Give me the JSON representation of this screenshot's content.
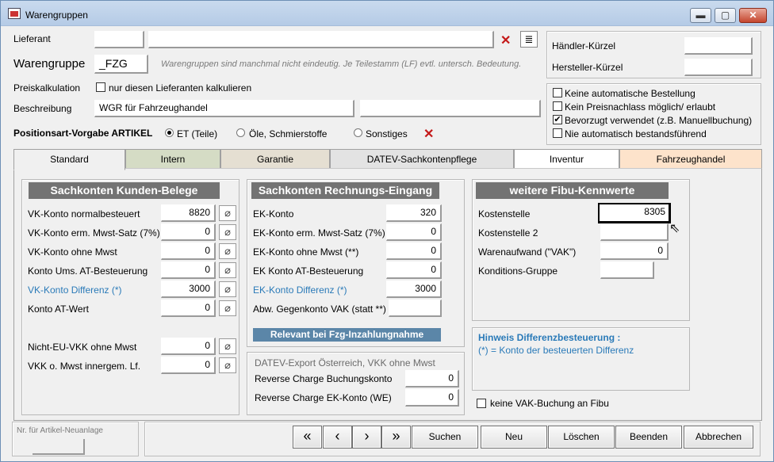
{
  "window": {
    "title": "Warengruppen",
    "minimize": "▬",
    "maximize": "▢",
    "close": "✕"
  },
  "header": {
    "lieferant_label": "Lieferant",
    "lieferant_code": "",
    "lieferant_name": "",
    "warengruppe_label": "Warengruppe",
    "warengruppe_value": "_FZG",
    "warengruppe_hint": "Warengruppen sind manchmal nicht eindeutig. Je Teilestamm (LF) evtl. untersch. Bedeutung.",
    "preiskalk_label": "Preiskalkulation",
    "preiskalk_checkbox": "nur diesen Lieferanten kalkulieren",
    "beschreibung_label": "Beschreibung",
    "beschreibung_value": "WGR für Fahrzeughandel",
    "beschreibung_value2": "",
    "positionsart_label": "Positionsart-Vorgabe ARTIKEL",
    "radio_et": "ET (Teile)",
    "radio_oele": "Öle, Schmierstoffe",
    "radio_sonstiges": "Sonstiges",
    "haendler_label": "Händler-Kürzel",
    "haendler_value": "",
    "hersteller_label": "Hersteller-Kürzel",
    "hersteller_value": ""
  },
  "options": [
    {
      "label": "Keine automatische Bestellung",
      "checked": false
    },
    {
      "label": "Kein Preisnachlass möglich/ erlaubt",
      "checked": false
    },
    {
      "label": "Bevorzugt verwendet (z.B. Manuellbuchung)",
      "checked": true
    },
    {
      "label": "Nie automatisch bestandsführend",
      "checked": false
    }
  ],
  "tabs": [
    {
      "label": "Standard",
      "color": "#f0f0f0"
    },
    {
      "label": "Intern",
      "color": "#d5dcc5"
    },
    {
      "label": "Garantie",
      "color": "#e5dfd2"
    },
    {
      "label": "DATEV-Sachkontenpflege",
      "color": "#e3e3e3"
    },
    {
      "label": "Inventur",
      "color": "#ffffff"
    },
    {
      "label": "Fahrzeughandel",
      "color": "#fde3cb"
    }
  ],
  "kunden": {
    "title": "Sachkonten Kunden-Belege",
    "rows": [
      {
        "label": "VK-Konto normalbesteuert",
        "value": "8820"
      },
      {
        "label": "VK-Konto erm. Mwst-Satz (7%)",
        "value": "0"
      },
      {
        "label": "VK-Konto ohne Mwst",
        "value": "0"
      },
      {
        "label": "Konto Ums. AT-Besteuerung",
        "value": "0"
      },
      {
        "label": "VK-Konto Differenz (*)",
        "value": "3000"
      },
      {
        "label": "Konto AT-Wert",
        "value": "0"
      },
      {
        "label": "Nicht-EU-VKK ohne Mwst",
        "value": "0"
      },
      {
        "label": "VKK o. Mwst innergem. Lf.",
        "value": "0"
      }
    ]
  },
  "rechnung": {
    "title": "Sachkonten Rechnungs-Eingang",
    "rows": [
      {
        "label": "EK-Konto",
        "value": "320"
      },
      {
        "label": "EK-Konto erm. Mwst-Satz (7%)",
        "value": "0"
      },
      {
        "label": "EK-Konto ohne Mwst (**)",
        "value": "0"
      },
      {
        "label": "EK Konto AT-Besteuerung",
        "value": "0"
      },
      {
        "label": "EK-Konto Differenz (*)",
        "value": "3000"
      },
      {
        "label": "Abw. Gegenkonto VAK (statt **)",
        "value": ""
      }
    ],
    "relevant": "Relevant bei Fzg-Inzahlungnahme"
  },
  "datev": {
    "title": "DATEV-Export Österreich, VKK ohne Mwst",
    "rows": [
      {
        "label": "Reverse Charge Buchungskonto",
        "value": "0"
      },
      {
        "label": "Reverse Charge EK-Konto (WE)",
        "value": "0"
      }
    ]
  },
  "fibu": {
    "title": "weitere Fibu-Kennwerte",
    "rows": [
      {
        "label": "Kostenstelle",
        "value": "8305"
      },
      {
        "label": "Kostenstelle 2",
        "value": ""
      },
      {
        "label": "Warenaufwand (\"VAK\")",
        "value": "0"
      },
      {
        "label": "Konditions-Gruppe",
        "value": ""
      }
    ]
  },
  "hinweis": {
    "title": "Hinweis Differenzbesteuerung :",
    "text": "(*) = Konto der besteuerten Differenz"
  },
  "vak_checkbox": "keine VAK-Buchung an Fibu",
  "footer": {
    "neuanlage_label": "Nr. für Artikel-Neuanlage",
    "neuanlage_value": "",
    "nav": [
      "«",
      "‹",
      "›",
      "»"
    ],
    "suchen": "Suchen",
    "neu": "Neu",
    "loeschen": "Löschen",
    "beenden": "Beenden",
    "abbrechen": "Abbrechen"
  }
}
